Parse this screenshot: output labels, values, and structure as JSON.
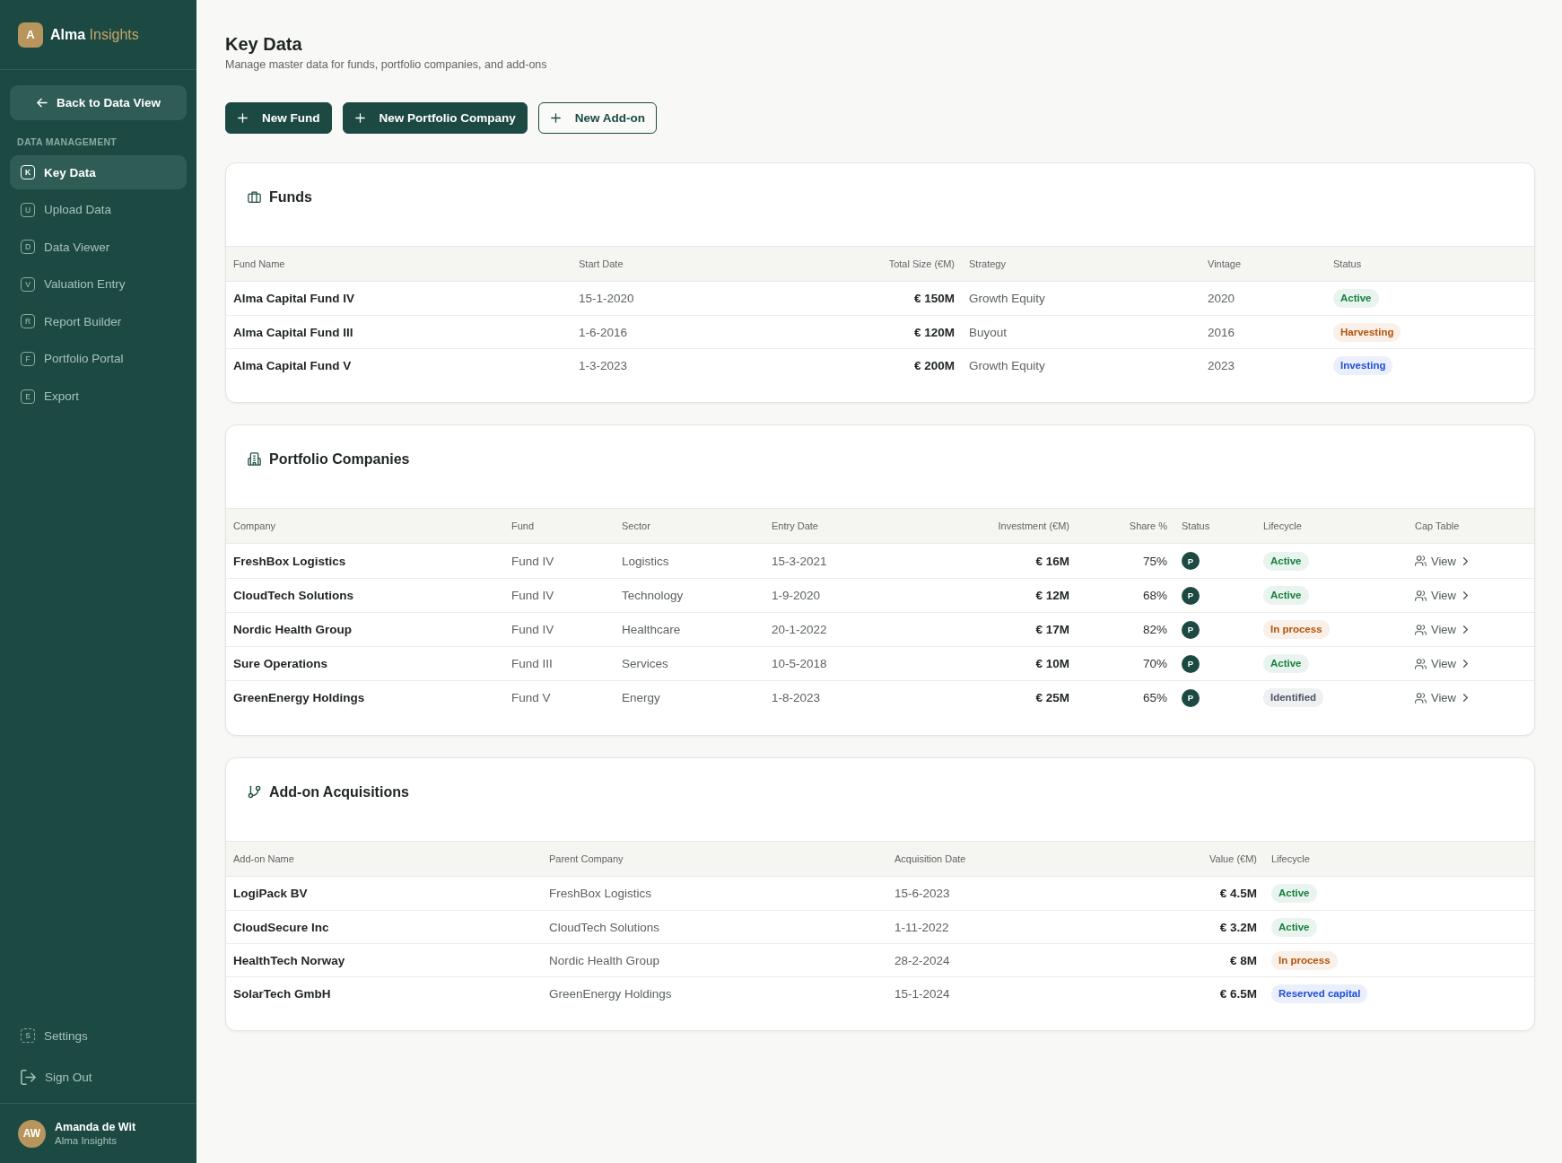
{
  "sidebar": {
    "brand": {
      "initial": "A",
      "name": "Alma",
      "accent": "Insights"
    },
    "back_button": "Back to Data View",
    "section_label": "DATA MANAGEMENT",
    "nav_items": [
      {
        "key": "K",
        "label": "Key Data",
        "selected": true
      },
      {
        "key": "U",
        "label": "Upload Data",
        "selected": false
      },
      {
        "key": "D",
        "label": "Data Viewer",
        "selected": false
      },
      {
        "key": "V",
        "label": "Valuation Entry",
        "selected": false
      },
      {
        "key": "R",
        "label": "Report Builder",
        "selected": false
      },
      {
        "key": "F",
        "label": "Portfolio Portal",
        "selected": false
      },
      {
        "key": "E",
        "label": "Export",
        "selected": false
      }
    ],
    "settings": {
      "key": "S",
      "label": "Settings"
    },
    "sign_out": "Sign Out",
    "user": {
      "initials": "AW",
      "name": "Amanda de Wit",
      "org": "Alma Insights"
    }
  },
  "page": {
    "title": "Key Data",
    "subtitle": "Manage master data for funds, portfolio companies, and add-ons"
  },
  "actions": [
    {
      "label": "New Fund",
      "kind": "primary"
    },
    {
      "label": "New Portfolio Company",
      "kind": "primary"
    },
    {
      "label": "New Add-on",
      "kind": "outline"
    }
  ],
  "funds": {
    "title": "Funds",
    "columns": [
      "Fund Name",
      "Start Date",
      "Total Size (€M)",
      "Strategy",
      "Vintage",
      "Status"
    ],
    "rows": [
      {
        "name": "Alma Capital Fund IV",
        "start_date": "15-1-2020",
        "total_size": "€ 150M",
        "strategy": "Growth Equity",
        "vintage": "2020",
        "status": {
          "label": "Active",
          "color": "#15803d"
        }
      },
      {
        "name": "Alma Capital Fund III",
        "start_date": "1-6-2016",
        "total_size": "€ 120M",
        "strategy": "Buyout",
        "vintage": "2016",
        "status": {
          "label": "Harvesting",
          "color": "#b45309"
        }
      },
      {
        "name": "Alma Capital Fund V",
        "start_date": "1-3-2023",
        "total_size": "€ 200M",
        "strategy": "Growth Equity",
        "vintage": "2023",
        "status": {
          "label": "Investing",
          "color": "#1d4ed8"
        }
      }
    ]
  },
  "portfolio_companies": {
    "title": "Portfolio Companies",
    "columns": [
      "Company",
      "Fund",
      "Sector",
      "Entry Date",
      "Investment (€M)",
      "Share %",
      "Status",
      "Lifecycle",
      "Cap Table"
    ],
    "rows": [
      {
        "company": "FreshBox Logistics",
        "fund": "Fund IV",
        "sector": "Logistics",
        "entry_date": "15-3-2021",
        "investment": "€ 16M",
        "share": "75%",
        "status": "P",
        "lifecycle": {
          "label": "Active",
          "color": "#15803d"
        },
        "cap_table": "View"
      },
      {
        "company": "CloudTech Solutions",
        "fund": "Fund IV",
        "sector": "Technology",
        "entry_date": "1-9-2020",
        "investment": "€ 12M",
        "share": "68%",
        "status": "P",
        "lifecycle": {
          "label": "Active",
          "color": "#15803d"
        },
        "cap_table": "View"
      },
      {
        "company": "Nordic Health Group",
        "fund": "Fund IV",
        "sector": "Healthcare",
        "entry_date": "20-1-2022",
        "investment": "€ 17M",
        "share": "82%",
        "status": "P",
        "lifecycle": {
          "label": "In process",
          "color": "#b45309"
        },
        "cap_table": "View"
      },
      {
        "company": "Sure Operations",
        "fund": "Fund III",
        "sector": "Services",
        "entry_date": "10-5-2018",
        "investment": "€ 10M",
        "share": "70%",
        "status": "P",
        "lifecycle": {
          "label": "Active",
          "color": "#15803d"
        },
        "cap_table": "View"
      },
      {
        "company": "GreenEnergy Holdings",
        "fund": "Fund V",
        "sector": "Energy",
        "entry_date": "1-8-2023",
        "investment": "€ 25M",
        "share": "65%",
        "status": "P",
        "lifecycle": {
          "label": "Identified",
          "color": "#4b5563"
        },
        "cap_table": "View"
      }
    ]
  },
  "add_on_acquisitions": {
    "title": "Add-on Acquisitions",
    "columns": [
      "Add-on Name",
      "Parent Company",
      "Acquisition Date",
      "Value (€M)",
      "Lifecycle"
    ],
    "rows": [
      {
        "name": "LogiPack BV",
        "parent_company": "FreshBox Logistics",
        "acquisition_date": "15-6-2023",
        "value": "€ 4.5M",
        "lifecycle": {
          "label": "Active",
          "color": "#15803d"
        }
      },
      {
        "name": "CloudSecure Inc",
        "parent_company": "CloudTech Solutions",
        "acquisition_date": "1-11-2022",
        "value": "€ 3.2M",
        "lifecycle": {
          "label": "Active",
          "color": "#15803d"
        }
      },
      {
        "name": "HealthTech Norway",
        "parent_company": "Nordic Health Group",
        "acquisition_date": "28-2-2024",
        "value": "€ 8M",
        "lifecycle": {
          "label": "In process",
          "color": "#b45309"
        }
      },
      {
        "name": "SolarTech GmbH",
        "parent_company": "GreenEnergy Holdings",
        "acquisition_date": "15-1-2024",
        "value": "€ 6.5M",
        "lifecycle": {
          "label": "Reserved capital",
          "color": "#1d4ed8"
        }
      }
    ]
  }
}
